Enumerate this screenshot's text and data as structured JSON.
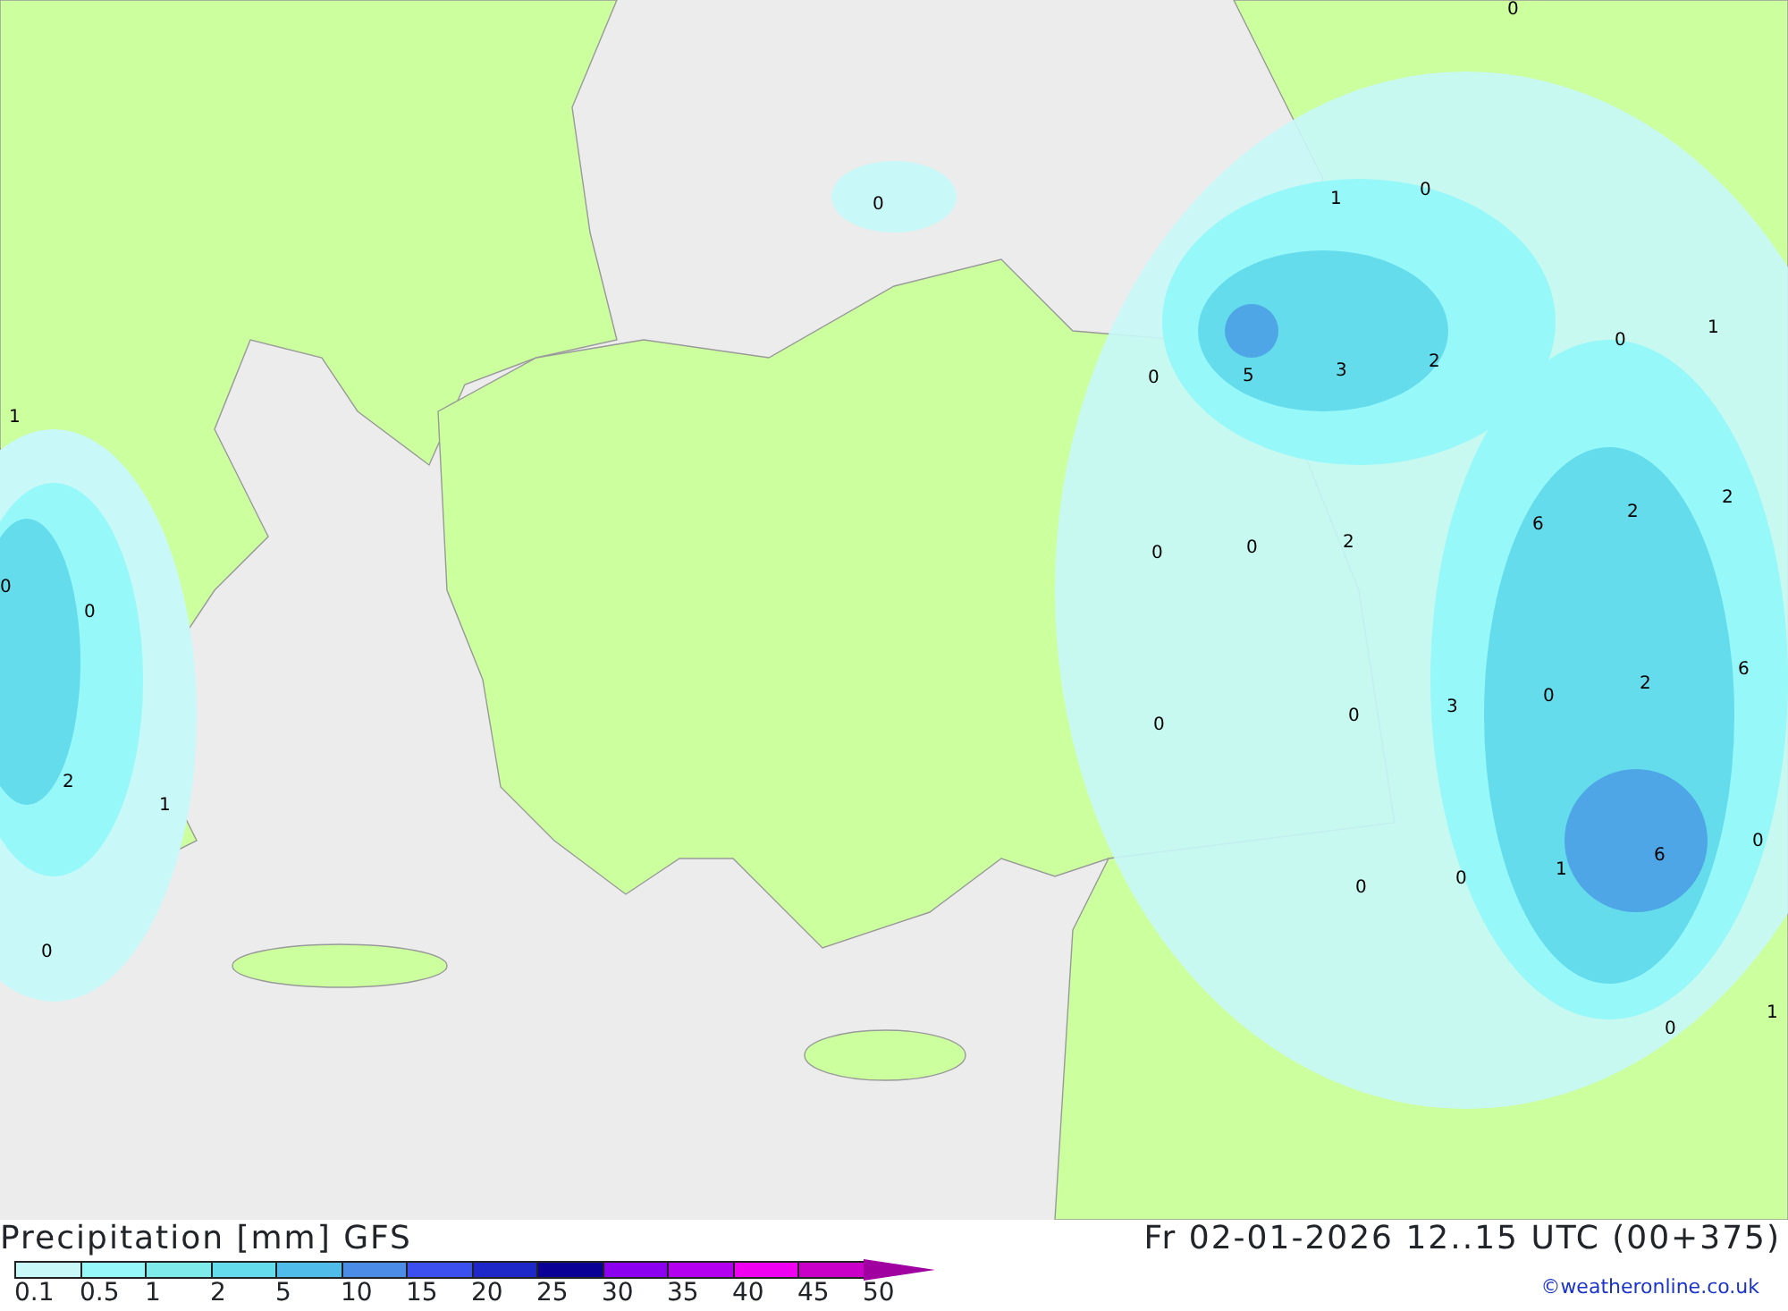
{
  "map": {
    "labels": [
      "0",
      "0",
      "1",
      "0",
      "1",
      "0",
      "0",
      "5",
      "3",
      "2",
      "1",
      "2",
      "2",
      "6",
      "0",
      "0",
      "2",
      "0",
      "0",
      "6",
      "3",
      "0",
      "2",
      "0",
      "0",
      "2",
      "1",
      "0",
      "6",
      "1",
      "0",
      "0",
      "0",
      "0",
      "1"
    ]
  },
  "footer": {
    "title": "Precipitation [mm] GFS",
    "datetime": "Fr 02-01-2026 12..15 UTC (00+375)",
    "credit": "©weatheronline.co.uk",
    "legend": [
      {
        "color": "#c8f8f8"
      },
      {
        "color": "#96f8f8"
      },
      {
        "color": "#7eeaea"
      },
      {
        "color": "#64dcec"
      },
      {
        "color": "#50bcea"
      },
      {
        "color": "#4b8ce6"
      },
      {
        "color": "#3c50f0"
      },
      {
        "color": "#1e28c8"
      },
      {
        "color": "#0a0096"
      },
      {
        "color": "#8c00f0"
      },
      {
        "color": "#b400f0"
      },
      {
        "color": "#f000f0"
      },
      {
        "color": "#c800c8"
      }
    ],
    "legend_labels": [
      "0.1",
      "0.5",
      "1",
      "2",
      "5",
      "10",
      "15",
      "20",
      "25",
      "30",
      "35",
      "40",
      "45",
      "50"
    ]
  }
}
